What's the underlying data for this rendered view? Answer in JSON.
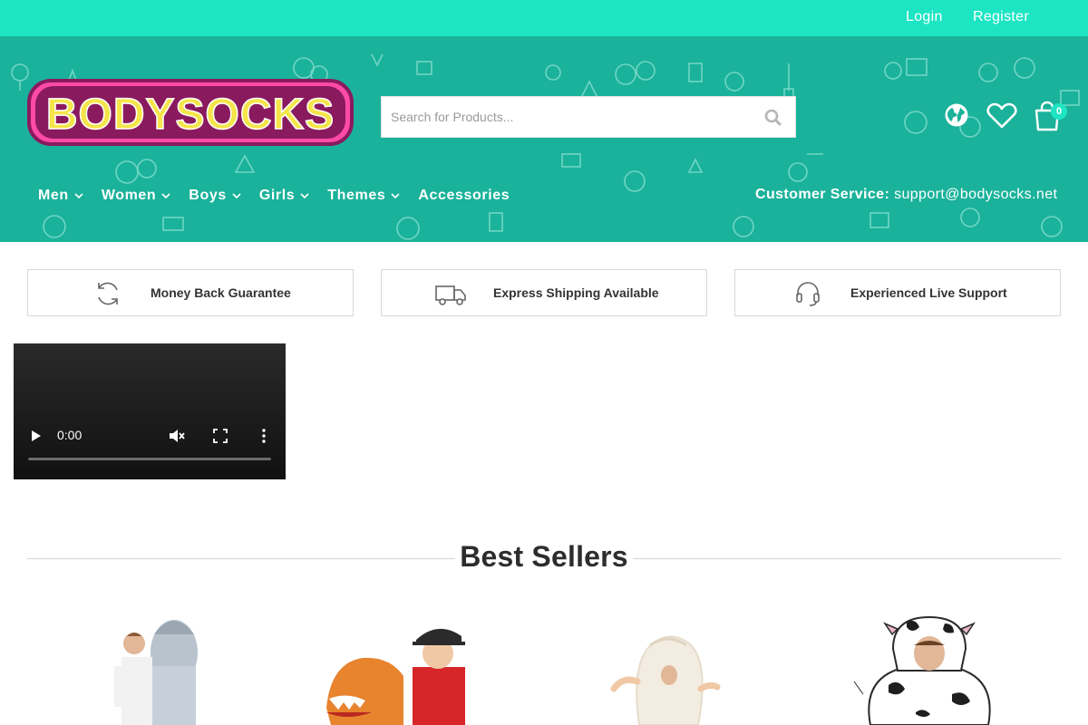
{
  "topbar": {
    "login": "Login",
    "register": "Register"
  },
  "header": {
    "logo_text": "BODYSOCKS",
    "search": {
      "placeholder": "Search for Products..."
    },
    "icons": {
      "globe": "globe-icon",
      "wishlist": "heart-icon",
      "cart": "shopping-bag-icon"
    },
    "cart_count": "0",
    "nav": [
      {
        "label": "Men",
        "dropdown": true
      },
      {
        "label": "Women",
        "dropdown": true
      },
      {
        "label": "Boys",
        "dropdown": true
      },
      {
        "label": "Girls",
        "dropdown": true
      },
      {
        "label": "Themes",
        "dropdown": true
      },
      {
        "label": "Accessories",
        "dropdown": false
      }
    ],
    "customer_service": {
      "label": "Customer Service:",
      "email": "support@bodysocks.net"
    }
  },
  "features": [
    {
      "icon": "refresh-icon",
      "text": "Money Back Guarantee"
    },
    {
      "icon": "truck-icon",
      "text": "Express Shipping Available"
    },
    {
      "icon": "headset-icon",
      "text": "Experienced Live Support"
    }
  ],
  "video": {
    "time": "0:00"
  },
  "best_sellers": {
    "title": "Best Sellers"
  },
  "products": [
    {
      "image": "inflatable-rocket-costume"
    },
    {
      "image": "inflatable-dinosaur-costume"
    },
    {
      "image": "inflatable-dumpling-costume"
    },
    {
      "image": "inflatable-cow-costume"
    }
  ],
  "colors": {
    "topbar": "#1de5c4",
    "header": "#1ab29a",
    "logo_fill": "#f5e54a",
    "logo_outline": "#8a1a5e"
  }
}
